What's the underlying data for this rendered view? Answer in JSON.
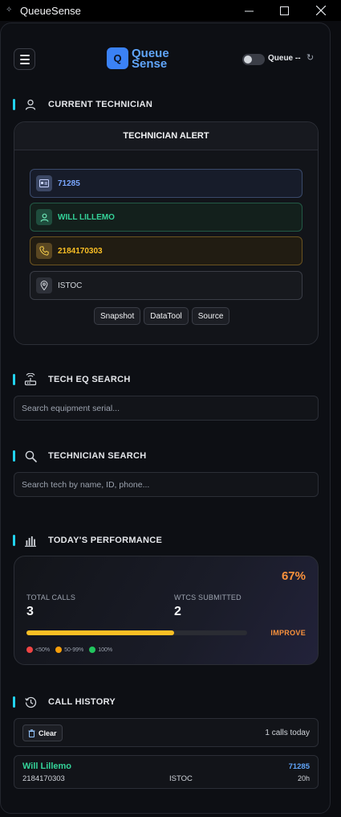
{
  "window": {
    "title": "QueueSense"
  },
  "header": {
    "logo_mark": "Q",
    "logo_line1": "Queue",
    "logo_line2": "Sense",
    "queue_label": "Queue --"
  },
  "sections": {
    "current_technician": "CURRENT TECHNICIAN",
    "tech_eq_search": "TECH EQ SEARCH",
    "technician_search": "TECHNICIAN SEARCH",
    "performance": "TODAY'S PERFORMANCE",
    "call_history": "CALL HISTORY"
  },
  "alert": {
    "title": "TECHNICIAN ALERT",
    "tech_id": "71285",
    "tech_name": "WILL LILLEMO",
    "phone": "2184170303",
    "location": "ISTOC",
    "buttons": [
      "Snapshot",
      "DataTool",
      "Source"
    ]
  },
  "eq_search": {
    "placeholder": "Search equipment serial..."
  },
  "tech_search": {
    "placeholder": "Search tech by name, ID, phone..."
  },
  "performance": {
    "percent": "67%",
    "progress_fraction": 0.67,
    "total_calls_label": "TOTAL CALLS",
    "total_calls": "3",
    "wtcs_label": "WTCS SUBMITTED",
    "wtcs": "2",
    "status": "IMPROVE",
    "legend": [
      {
        "label": "<50%",
        "color": "#ef4444"
      },
      {
        "label": "50-99%",
        "color": "#f59e0b"
      },
      {
        "label": "100%",
        "color": "#22c55e"
      }
    ]
  },
  "history": {
    "clear_label": "Clear",
    "count_text": "1 calls today",
    "items": [
      {
        "name": "Will Lillemo",
        "phone": "2184170303",
        "location": "ISTOC",
        "id": "71285",
        "age": "20h"
      }
    ]
  },
  "colors": {
    "accent": "#22d3ee",
    "brand": "#3b82f6",
    "progress": "#fbbf24",
    "warn": "#fb923c"
  }
}
